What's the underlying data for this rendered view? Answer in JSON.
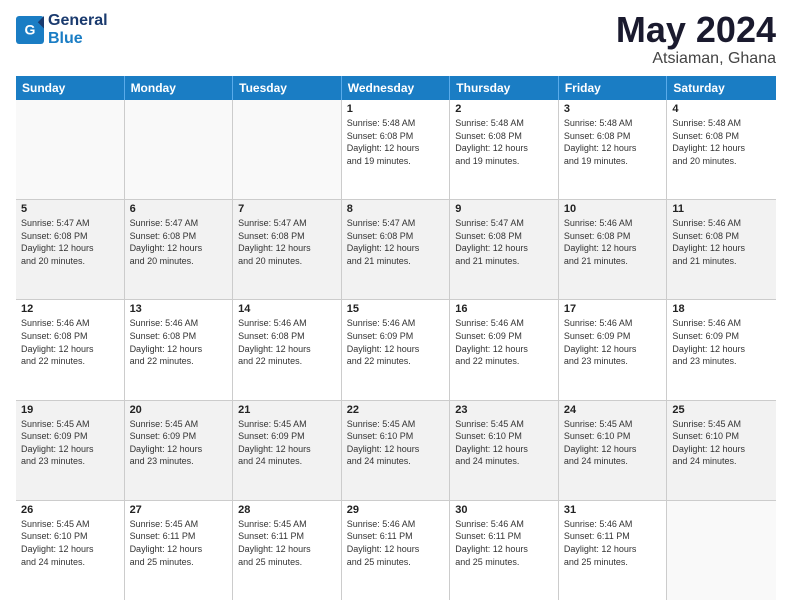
{
  "header": {
    "logo_general": "General",
    "logo_blue": "Blue",
    "month": "May 2024",
    "location": "Atsiaman, Ghana"
  },
  "weekdays": [
    "Sunday",
    "Monday",
    "Tuesday",
    "Wednesday",
    "Thursday",
    "Friday",
    "Saturday"
  ],
  "weeks": [
    {
      "shade": false,
      "days": [
        {
          "num": "",
          "info": ""
        },
        {
          "num": "",
          "info": ""
        },
        {
          "num": "",
          "info": ""
        },
        {
          "num": "1",
          "info": "Sunrise: 5:48 AM\nSunset: 6:08 PM\nDaylight: 12 hours\nand 19 minutes."
        },
        {
          "num": "2",
          "info": "Sunrise: 5:48 AM\nSunset: 6:08 PM\nDaylight: 12 hours\nand 19 minutes."
        },
        {
          "num": "3",
          "info": "Sunrise: 5:48 AM\nSunset: 6:08 PM\nDaylight: 12 hours\nand 19 minutes."
        },
        {
          "num": "4",
          "info": "Sunrise: 5:48 AM\nSunset: 6:08 PM\nDaylight: 12 hours\nand 20 minutes."
        }
      ]
    },
    {
      "shade": true,
      "days": [
        {
          "num": "5",
          "info": "Sunrise: 5:47 AM\nSunset: 6:08 PM\nDaylight: 12 hours\nand 20 minutes."
        },
        {
          "num": "6",
          "info": "Sunrise: 5:47 AM\nSunset: 6:08 PM\nDaylight: 12 hours\nand 20 minutes."
        },
        {
          "num": "7",
          "info": "Sunrise: 5:47 AM\nSunset: 6:08 PM\nDaylight: 12 hours\nand 20 minutes."
        },
        {
          "num": "8",
          "info": "Sunrise: 5:47 AM\nSunset: 6:08 PM\nDaylight: 12 hours\nand 21 minutes."
        },
        {
          "num": "9",
          "info": "Sunrise: 5:47 AM\nSunset: 6:08 PM\nDaylight: 12 hours\nand 21 minutes."
        },
        {
          "num": "10",
          "info": "Sunrise: 5:46 AM\nSunset: 6:08 PM\nDaylight: 12 hours\nand 21 minutes."
        },
        {
          "num": "11",
          "info": "Sunrise: 5:46 AM\nSunset: 6:08 PM\nDaylight: 12 hours\nand 21 minutes."
        }
      ]
    },
    {
      "shade": false,
      "days": [
        {
          "num": "12",
          "info": "Sunrise: 5:46 AM\nSunset: 6:08 PM\nDaylight: 12 hours\nand 22 minutes."
        },
        {
          "num": "13",
          "info": "Sunrise: 5:46 AM\nSunset: 6:08 PM\nDaylight: 12 hours\nand 22 minutes."
        },
        {
          "num": "14",
          "info": "Sunrise: 5:46 AM\nSunset: 6:08 PM\nDaylight: 12 hours\nand 22 minutes."
        },
        {
          "num": "15",
          "info": "Sunrise: 5:46 AM\nSunset: 6:09 PM\nDaylight: 12 hours\nand 22 minutes."
        },
        {
          "num": "16",
          "info": "Sunrise: 5:46 AM\nSunset: 6:09 PM\nDaylight: 12 hours\nand 22 minutes."
        },
        {
          "num": "17",
          "info": "Sunrise: 5:46 AM\nSunset: 6:09 PM\nDaylight: 12 hours\nand 23 minutes."
        },
        {
          "num": "18",
          "info": "Sunrise: 5:46 AM\nSunset: 6:09 PM\nDaylight: 12 hours\nand 23 minutes."
        }
      ]
    },
    {
      "shade": true,
      "days": [
        {
          "num": "19",
          "info": "Sunrise: 5:45 AM\nSunset: 6:09 PM\nDaylight: 12 hours\nand 23 minutes."
        },
        {
          "num": "20",
          "info": "Sunrise: 5:45 AM\nSunset: 6:09 PM\nDaylight: 12 hours\nand 23 minutes."
        },
        {
          "num": "21",
          "info": "Sunrise: 5:45 AM\nSunset: 6:09 PM\nDaylight: 12 hours\nand 24 minutes."
        },
        {
          "num": "22",
          "info": "Sunrise: 5:45 AM\nSunset: 6:10 PM\nDaylight: 12 hours\nand 24 minutes."
        },
        {
          "num": "23",
          "info": "Sunrise: 5:45 AM\nSunset: 6:10 PM\nDaylight: 12 hours\nand 24 minutes."
        },
        {
          "num": "24",
          "info": "Sunrise: 5:45 AM\nSunset: 6:10 PM\nDaylight: 12 hours\nand 24 minutes."
        },
        {
          "num": "25",
          "info": "Sunrise: 5:45 AM\nSunset: 6:10 PM\nDaylight: 12 hours\nand 24 minutes."
        }
      ]
    },
    {
      "shade": false,
      "days": [
        {
          "num": "26",
          "info": "Sunrise: 5:45 AM\nSunset: 6:10 PM\nDaylight: 12 hours\nand 24 minutes."
        },
        {
          "num": "27",
          "info": "Sunrise: 5:45 AM\nSunset: 6:11 PM\nDaylight: 12 hours\nand 25 minutes."
        },
        {
          "num": "28",
          "info": "Sunrise: 5:45 AM\nSunset: 6:11 PM\nDaylight: 12 hours\nand 25 minutes."
        },
        {
          "num": "29",
          "info": "Sunrise: 5:46 AM\nSunset: 6:11 PM\nDaylight: 12 hours\nand 25 minutes."
        },
        {
          "num": "30",
          "info": "Sunrise: 5:46 AM\nSunset: 6:11 PM\nDaylight: 12 hours\nand 25 minutes."
        },
        {
          "num": "31",
          "info": "Sunrise: 5:46 AM\nSunset: 6:11 PM\nDaylight: 12 hours\nand 25 minutes."
        },
        {
          "num": "",
          "info": ""
        }
      ]
    }
  ]
}
